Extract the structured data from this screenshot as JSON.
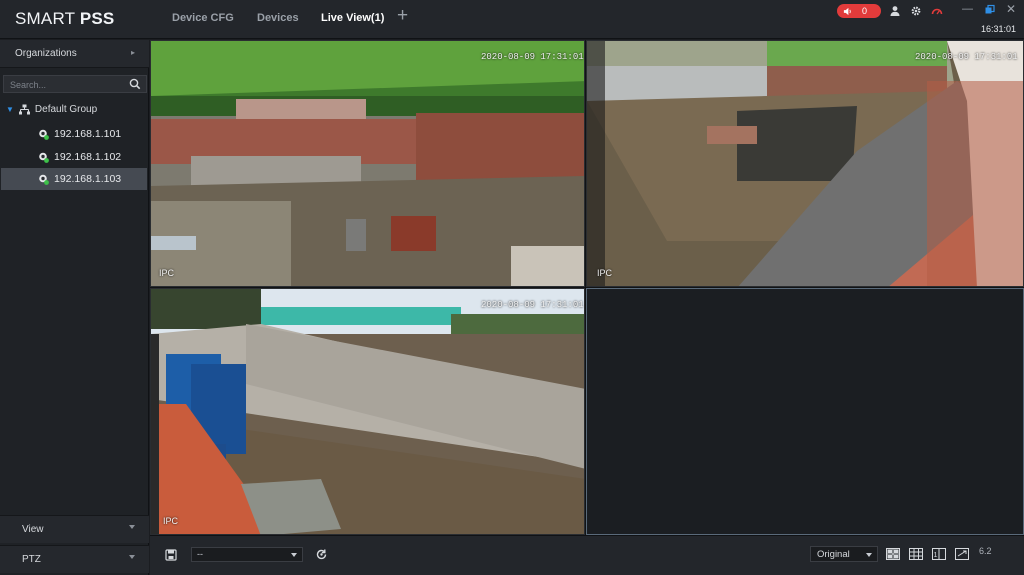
{
  "app": {
    "logo_regular": "SMART ",
    "logo_bold": "PSS"
  },
  "tabs": [
    {
      "label": "Device CFG",
      "active": false
    },
    {
      "label": "Devices",
      "active": false
    },
    {
      "label": "Live View(1)",
      "active": true
    }
  ],
  "add_tab_label": "+",
  "header": {
    "alarm_count": "0",
    "clock": "16:31:01"
  },
  "sidebar": {
    "organizations_label": "Organizations",
    "search_placeholder": "Search...",
    "group_label": "Default Group",
    "devices": [
      {
        "label": "192.168.1.101",
        "selected": false
      },
      {
        "label": "192.168.1.102",
        "selected": false
      },
      {
        "label": "192.168.1.103",
        "selected": true
      }
    ],
    "view_label": "View",
    "ptz_label": "PTZ"
  },
  "video": {
    "panes": [
      {
        "osd_time": "2020-08-09 17:31:01",
        "osd_label": "IPC"
      },
      {
        "osd_time": "2020-08-09 17:31:01",
        "osd_label": "IPC"
      },
      {
        "osd_time": "2020-08-09 17:31:01",
        "osd_label": "IPC"
      }
    ]
  },
  "bottom": {
    "view_select": "--",
    "ratio_select": "Original",
    "page_indicator": "6.2"
  },
  "colors": {
    "accent_blue": "#2f8fe6",
    "alarm_red": "#e23b3b",
    "online_green": "#3ec24a"
  }
}
